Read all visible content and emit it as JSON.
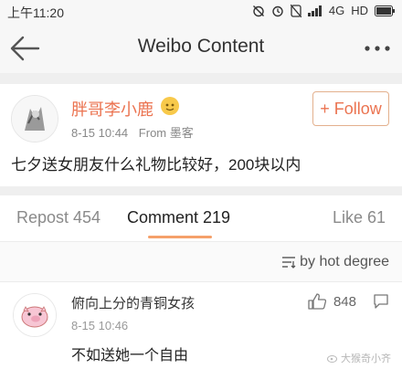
{
  "status_bar": {
    "time": "上午11:20",
    "network": "4G",
    "hd": "HD"
  },
  "nav": {
    "title": "Weibo Content"
  },
  "post": {
    "author": "胖哥李小鹿",
    "time": "8-15 10:44",
    "source": "From 墨客",
    "follow_label": "+ Follow",
    "text": "七夕送女朋友什么礼物比较好，200块以内"
  },
  "tabs": {
    "repost": "Repost 454",
    "comment": "Comment 219",
    "like": "Like 61"
  },
  "sort": {
    "label": "by hot degree"
  },
  "comment": {
    "author": "俯向上分的青铜女孩",
    "time": "8-15 10:46",
    "likes": "848",
    "text": "不如送她一个自由"
  },
  "watermark": {
    "text": "大猴奇小齐"
  },
  "colors": {
    "accent": "#eb7350",
    "tab_indicator": "#f5a06a"
  }
}
